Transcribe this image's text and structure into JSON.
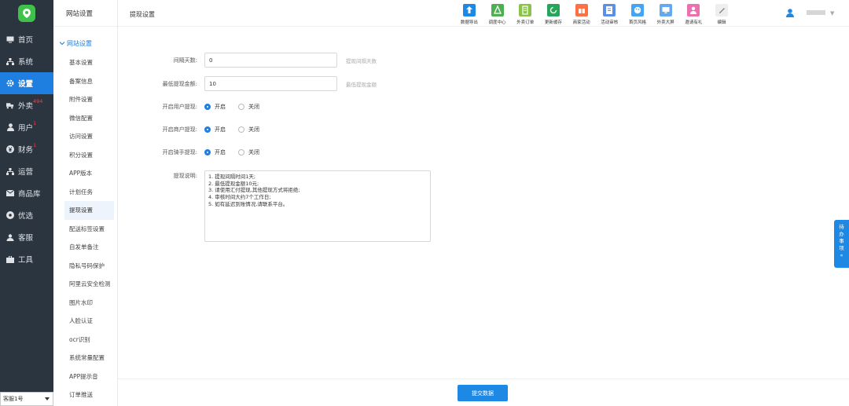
{
  "colors": {
    "sidebar_bg": "#2b3540",
    "accent": "#1f7fe0",
    "logo_green": "#3ec24a"
  },
  "sidebar": {
    "items": [
      {
        "label": "首页",
        "icon": "monitor-icon"
      },
      {
        "label": "系统",
        "icon": "sitemap-icon"
      },
      {
        "label": "设置",
        "icon": "gear-icon",
        "active": true
      },
      {
        "label": "外卖",
        "icon": "delivery-icon",
        "badge": "494"
      },
      {
        "label": "用户",
        "icon": "user-icon",
        "badge": "1"
      },
      {
        "label": "财务",
        "icon": "yen-icon",
        "badge": "1"
      },
      {
        "label": "运营",
        "icon": "sitemap-icon"
      },
      {
        "label": "商品库",
        "icon": "mail-icon"
      },
      {
        "label": "优选",
        "icon": "circle-icon"
      },
      {
        "label": "客服",
        "icon": "headset-icon"
      },
      {
        "label": "工具",
        "icon": "toolbox-icon"
      }
    ],
    "select_value": "客服1号"
  },
  "subnav": {
    "header": "网站设置",
    "group": "网站设置",
    "items": [
      "基本设置",
      "备案信息",
      "附件设置",
      "微信配置",
      "访问设置",
      "积分设置",
      "APP版本",
      "计划任务",
      "提现设置",
      "配送标签设置",
      "自发单备注",
      "隐私号码保护",
      "阿里云安全检测",
      "图片水印",
      "人脸认证",
      "ocr识别",
      "系统常量配置",
      "APP提示音",
      "订单推送"
    ],
    "active": "提现设置"
  },
  "topbar": {
    "title": "提现设置",
    "tools": [
      {
        "label": "数据导出",
        "icon": "upload-icon",
        "color": "#1e88e5"
      },
      {
        "label": "调度中心",
        "icon": "dispatch-icon",
        "color": "#4caf50"
      },
      {
        "label": "外卖订单",
        "icon": "clipboard-icon",
        "color": "#8bc34a"
      },
      {
        "label": "更新缓存",
        "icon": "refresh-icon",
        "color": "#26a65b"
      },
      {
        "label": "商家活动",
        "icon": "gift-icon",
        "color": "#ff7043"
      },
      {
        "label": "活动审核",
        "icon": "flag-icon",
        "color": "#5c8fe6"
      },
      {
        "label": "首页风格",
        "icon": "palette-icon",
        "color": "#42a5f5"
      },
      {
        "label": "外卖大屏",
        "icon": "screen-icon",
        "color": "#64a8f0"
      },
      {
        "label": "邀请有礼",
        "icon": "person-icon",
        "color": "#ec6fb0"
      },
      {
        "label": "编辑",
        "icon": "pencil-icon",
        "color": "#eeeeee"
      }
    ]
  },
  "form": {
    "interval_days": {
      "label": "间隔天数:",
      "value": "0",
      "hint": "提现间隔天数"
    },
    "min_amount": {
      "label": "最低提现金额:",
      "value": "10",
      "hint": "最低提现金额"
    },
    "user_withdraw": {
      "label": "开启用户提现:",
      "on": "开启",
      "off": "关闭",
      "selected": "开启"
    },
    "merchant_withdraw": {
      "label": "开启商户提现:",
      "on": "开启",
      "off": "关闭",
      "selected": "开启"
    },
    "rider_withdraw": {
      "label": "开启骑手提现:",
      "on": "开启",
      "off": "关闭",
      "selected": "开启"
    },
    "description": {
      "label": "提现说明:",
      "lines": [
        "1. 提现间隔时间1天;",
        "2. 最低提现金额10元;",
        "3. 请使用汇付提现,其他提现方式将拒绝;",
        "4. 审核时间大约7个工作日;",
        "5. 如有延迟到账情况,请联系平台。"
      ]
    }
  },
  "submit_label": "提交数据",
  "float_tab": [
    "待",
    "办",
    "事",
    "项",
    "«"
  ]
}
